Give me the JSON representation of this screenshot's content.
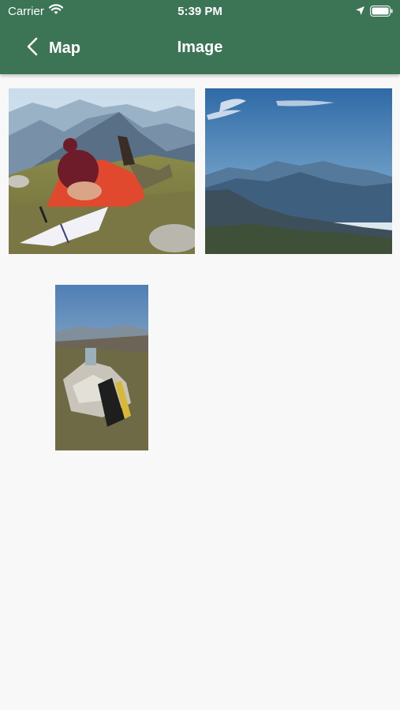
{
  "status_bar": {
    "carrier": "Carrier",
    "time": "5:39 PM",
    "wifi_icon": "wifi-icon",
    "location_icon": "location-arrow-icon",
    "battery_icon": "battery-icon"
  },
  "header": {
    "back_label": "Map",
    "back_icon": "chevron-left-icon",
    "title": "Image",
    "color": "#3b7556"
  },
  "gallery": {
    "images": [
      {
        "name": "photo-person-writing-on-mountain"
      },
      {
        "name": "photo-mountain-range-blue-sky"
      },
      {
        "name": "photo-stone-cairn-with-backpack"
      }
    ]
  }
}
